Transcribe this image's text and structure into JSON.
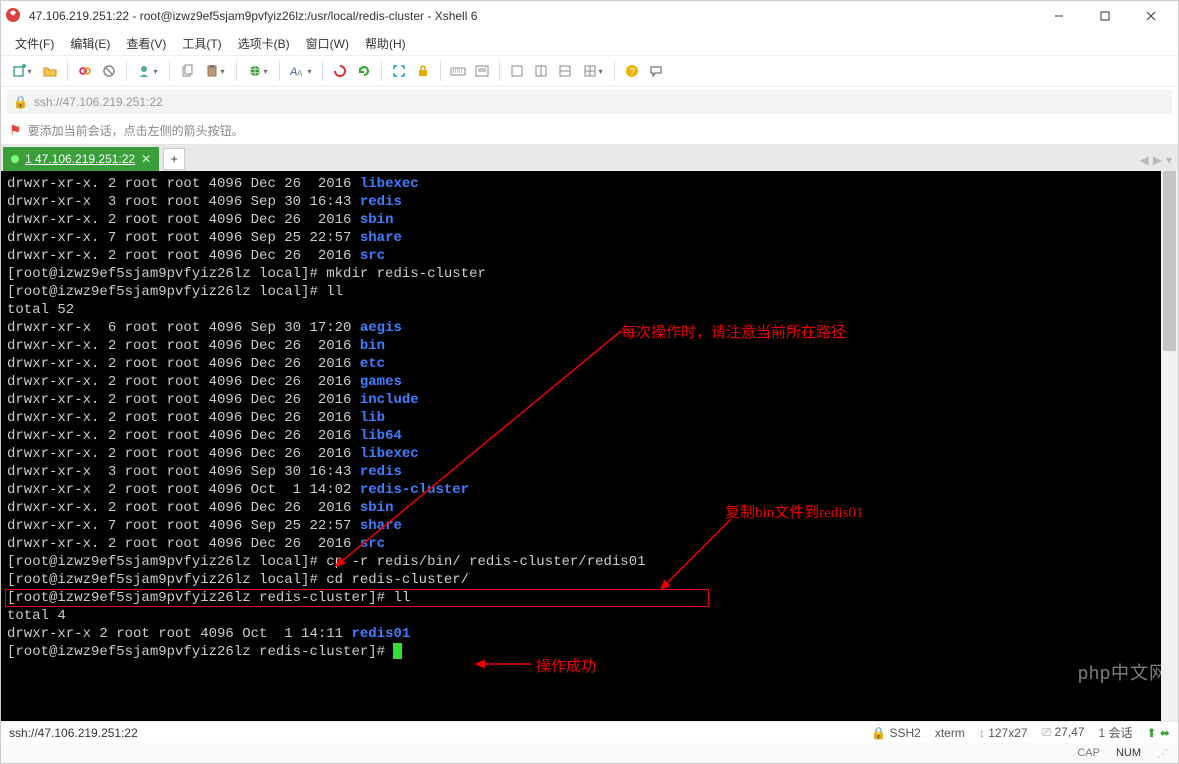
{
  "window": {
    "title": "47.106.219.251:22 - root@izwz9ef5sjam9pvfyiz26lz:/usr/local/redis-cluster - Xshell 6"
  },
  "menu": {
    "file": "文件(F)",
    "edit": "编辑(E)",
    "view": "查看(V)",
    "tools": "工具(T)",
    "tabs": "选项卡(B)",
    "window": "窗口(W)",
    "help": "帮助(H)"
  },
  "address": {
    "url": "ssh://47.106.219.251:22"
  },
  "tip": {
    "text": "要添加当前会话，点击左侧的箭头按钮。"
  },
  "tab": {
    "label": "1 47.106.219.251:22"
  },
  "terminal": {
    "lines": [
      {
        "perm": "drwxr-xr-x. 2 root root 4096 Dec 26  2016 ",
        "name": "libexec"
      },
      {
        "perm": "drwxr-xr-x  3 root root 4096 Sep 30 16:43 ",
        "name": "redis"
      },
      {
        "perm": "drwxr-xr-x. 2 root root 4096 Dec 26  2016 ",
        "name": "sbin"
      },
      {
        "perm": "drwxr-xr-x. 7 root root 4096 Sep 25 22:57 ",
        "name": "share"
      },
      {
        "perm": "drwxr-xr-x. 2 root root 4096 Dec 26  2016 ",
        "name": "src"
      }
    ],
    "cmd1": "[root@izwz9ef5sjam9pvfyiz26lz local]# mkdir redis-cluster",
    "cmd2": "[root@izwz9ef5sjam9pvfyiz26lz local]# ll",
    "total1": "total 52",
    "lines2": [
      {
        "perm": "drwxr-xr-x  6 root root 4096 Sep 30 17:20 ",
        "name": "aegis"
      },
      {
        "perm": "drwxr-xr-x. 2 root root 4096 Dec 26  2016 ",
        "name": "bin"
      },
      {
        "perm": "drwxr-xr-x. 2 root root 4096 Dec 26  2016 ",
        "name": "etc"
      },
      {
        "perm": "drwxr-xr-x. 2 root root 4096 Dec 26  2016 ",
        "name": "games"
      },
      {
        "perm": "drwxr-xr-x. 2 root root 4096 Dec 26  2016 ",
        "name": "include"
      },
      {
        "perm": "drwxr-xr-x. 2 root root 4096 Dec 26  2016 ",
        "name": "lib"
      },
      {
        "perm": "drwxr-xr-x. 2 root root 4096 Dec 26  2016 ",
        "name": "lib64"
      },
      {
        "perm": "drwxr-xr-x. 2 root root 4096 Dec 26  2016 ",
        "name": "libexec"
      },
      {
        "perm": "drwxr-xr-x  3 root root 4096 Sep 30 16:43 ",
        "name": "redis"
      },
      {
        "perm": "drwxr-xr-x  2 root root 4096 Oct  1 14:02 ",
        "name": "redis-cluster"
      },
      {
        "perm": "drwxr-xr-x. 2 root root 4096 Dec 26  2016 ",
        "name": "sbin"
      },
      {
        "perm": "drwxr-xr-x. 7 root root 4096 Sep 25 22:57 ",
        "name": "share"
      },
      {
        "perm": "drwxr-xr-x. 2 root root 4096 Dec 26  2016 ",
        "name": "src"
      }
    ],
    "cmd3": "[root@izwz9ef5sjam9pvfyiz26lz local]# cp -r redis/bin/ redis-cluster/redis01",
    "cmd4": "[root@izwz9ef5sjam9pvfyiz26lz local]# cd redis-cluster/",
    "cmd5": "[root@izwz9ef5sjam9pvfyiz26lz redis-cluster]# ll",
    "total2": "total 4",
    "line3_perm": "drwxr-xr-x 2 root root 4096 Oct  1 14:11 ",
    "line3_name": "redis01",
    "prompt": "[root@izwz9ef5sjam9pvfyiz26lz redis-cluster]# "
  },
  "annotations": {
    "a1": "每次操作时，请注意当前所在路径",
    "a2": "复制bin文件到redis01",
    "a3": "操作成功"
  },
  "status": {
    "left": "ssh://47.106.219.251:22",
    "ssh": "SSH2",
    "term": "xterm",
    "size": "127x27",
    "pos": "27,47",
    "sessions": "1 会话",
    "cap": "CAP",
    "num": "NUM"
  },
  "watermark": "php中文网"
}
